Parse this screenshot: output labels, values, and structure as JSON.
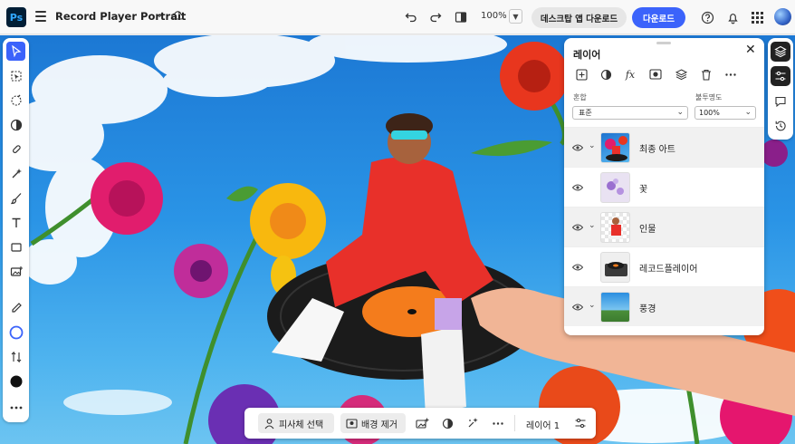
{
  "app": {
    "logo_text": "Ps",
    "document_title": "Record Player Portrait"
  },
  "header": {
    "zoom": "100%",
    "desktop_button": "데스크탑 앱 다운로드",
    "download_button": "다운로드"
  },
  "layers_panel": {
    "title": "레이어",
    "blend_label": "혼합",
    "blend_value": "표준",
    "opacity_label": "불투명도",
    "opacity_value": "100%",
    "toolbar_icons": [
      "add-layer-icon",
      "adjustment-icon",
      "fx-icon",
      "mask-icon",
      "stack-icon",
      "trash-icon",
      "more-icon"
    ],
    "layers": [
      {
        "name": "최종 아트",
        "expandable": true
      },
      {
        "name": "꽃",
        "expandable": false
      },
      {
        "name": "인물",
        "expandable": true
      },
      {
        "name": "레코드플레이어",
        "expandable": false
      },
      {
        "name": "풍경",
        "expandable": true
      }
    ]
  },
  "taskbar": {
    "select_subject": "피사체 선택",
    "remove_background": "배경 제거",
    "layer_label": "레이어 1"
  },
  "colors": {
    "accent": "#3b63fb",
    "ps_logo_bg": "#001e36",
    "ps_logo_fg": "#31a8ff"
  }
}
